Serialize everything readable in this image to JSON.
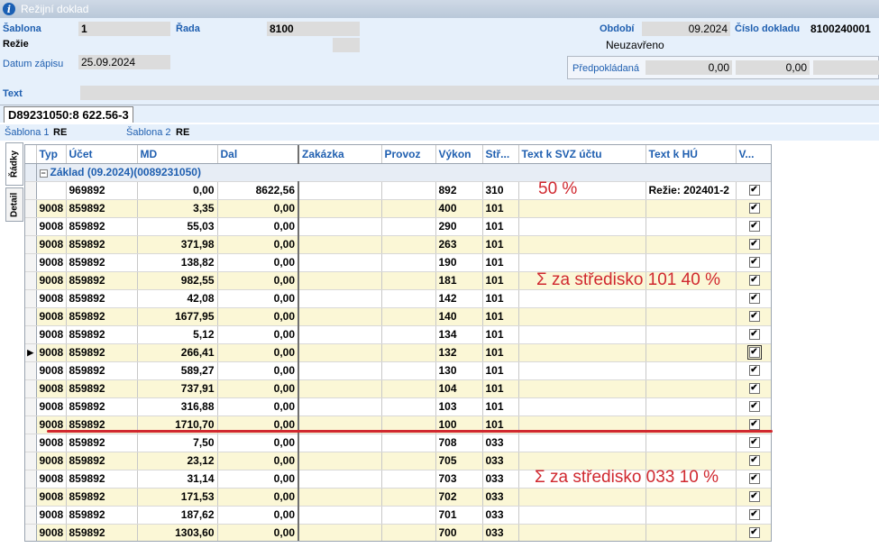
{
  "window": {
    "title": "Režijní doklad"
  },
  "header": {
    "sablona_label": "Šablona",
    "sablona_value": "1",
    "rada_label": "Řada",
    "rada_value": "8100",
    "rezie_label": "Režie",
    "obdobi_label": "Období",
    "obdobi_value": "09.2024",
    "cislo_label": "Číslo dokladu",
    "cislo_value": "8100240001",
    "status": "Neuzavřeno",
    "datum_label": "Datum zápisu",
    "datum_value": "25.09.2024",
    "predpokladana_label": "Předpokládaná",
    "predpokladana_v1": "0,00",
    "predpokladana_v2": "0,00",
    "text_label": "Text"
  },
  "doc_tab": "D89231050:8 622.56-3",
  "sablony": {
    "s1_label": "Šablona 1",
    "s1_value": "RE",
    "s2_label": "Šablona 2",
    "s2_value": "RE"
  },
  "side_tabs": [
    "Řádky",
    "Detail"
  ],
  "grid": {
    "columns": [
      "Typ",
      "Účet",
      "MD",
      "Dal",
      "Zakázka",
      "Provoz",
      "Výkon",
      "Stř...",
      "Text k SVZ účtu",
      "Text k HÚ",
      "V..."
    ],
    "group_label": "Základ (09.2024)(0089231050)",
    "rows": [
      {
        "typ": "",
        "ucet": "969892",
        "md": "0,00",
        "dal": "8622,56",
        "vykon": "892",
        "str": "310",
        "hu": "Režie: 202401-2",
        "checked": "✔"
      },
      {
        "typ": "9008",
        "ucet": "859892",
        "md": "3,35",
        "dal": "0,00",
        "vykon": "400",
        "str": "101",
        "hu": "",
        "checked": "✔"
      },
      {
        "typ": "9008",
        "ucet": "859892",
        "md": "55,03",
        "dal": "0,00",
        "vykon": "290",
        "str": "101",
        "hu": "",
        "checked": "✔"
      },
      {
        "typ": "9008",
        "ucet": "859892",
        "md": "371,98",
        "dal": "0,00",
        "vykon": "263",
        "str": "101",
        "hu": "",
        "checked": "✔"
      },
      {
        "typ": "9008",
        "ucet": "859892",
        "md": "138,82",
        "dal": "0,00",
        "vykon": "190",
        "str": "101",
        "hu": "",
        "checked": "✔"
      },
      {
        "typ": "9008",
        "ucet": "859892",
        "md": "982,55",
        "dal": "0,00",
        "vykon": "181",
        "str": "101",
        "hu": "",
        "checked": "✔"
      },
      {
        "typ": "9008",
        "ucet": "859892",
        "md": "42,08",
        "dal": "0,00",
        "vykon": "142",
        "str": "101",
        "hu": "",
        "checked": "✔"
      },
      {
        "typ": "9008",
        "ucet": "859892",
        "md": "1677,95",
        "dal": "0,00",
        "vykon": "140",
        "str": "101",
        "hu": "",
        "checked": "✔"
      },
      {
        "typ": "9008",
        "ucet": "859892",
        "md": "5,12",
        "dal": "0,00",
        "vykon": "134",
        "str": "101",
        "hu": "",
        "checked": "✔"
      },
      {
        "typ": "9008",
        "ucet": "859892",
        "md": "266,41",
        "dal": "0,00",
        "vykon": "132",
        "str": "101",
        "hu": "",
        "checked": "✔"
      },
      {
        "typ": "9008",
        "ucet": "859892",
        "md": "589,27",
        "dal": "0,00",
        "vykon": "130",
        "str": "101",
        "hu": "",
        "checked": "✔"
      },
      {
        "typ": "9008",
        "ucet": "859892",
        "md": "737,91",
        "dal": "0,00",
        "vykon": "104",
        "str": "101",
        "hu": "",
        "checked": "✔"
      },
      {
        "typ": "9008",
        "ucet": "859892",
        "md": "316,88",
        "dal": "0,00",
        "vykon": "103",
        "str": "101",
        "hu": "",
        "checked": "✔"
      },
      {
        "typ": "9008",
        "ucet": "859892",
        "md": "1710,70",
        "dal": "0,00",
        "vykon": "100",
        "str": "101",
        "hu": "",
        "checked": "✔"
      },
      {
        "typ": "9008",
        "ucet": "859892",
        "md": "7,50",
        "dal": "0,00",
        "vykon": "708",
        "str": "033",
        "hu": "",
        "checked": "✔"
      },
      {
        "typ": "9008",
        "ucet": "859892",
        "md": "23,12",
        "dal": "0,00",
        "vykon": "705",
        "str": "033",
        "hu": "",
        "checked": "✔"
      },
      {
        "typ": "9008",
        "ucet": "859892",
        "md": "31,14",
        "dal": "0,00",
        "vykon": "703",
        "str": "033",
        "hu": "",
        "checked": "✔"
      },
      {
        "typ": "9008",
        "ucet": "859892",
        "md": "171,53",
        "dal": "0,00",
        "vykon": "702",
        "str": "033",
        "hu": "",
        "checked": "✔"
      },
      {
        "typ": "9008",
        "ucet": "859892",
        "md": "187,62",
        "dal": "0,00",
        "vykon": "701",
        "str": "033",
        "hu": "",
        "checked": "✔"
      },
      {
        "typ": "9008",
        "ucet": "859892",
        "md": "1303,60",
        "dal": "0,00",
        "vykon": "700",
        "str": "033",
        "hu": "",
        "checked": "✔"
      }
    ]
  },
  "annotations": {
    "a1": "50 %",
    "a2": "Σ za středisko 101 40 %",
    "a3": "Σ za středisko 033 10 %"
  },
  "colors": {
    "label_blue": "#1f5fb0",
    "annotation_red": "#d0282f",
    "row_alt": "#fbf7d6"
  }
}
